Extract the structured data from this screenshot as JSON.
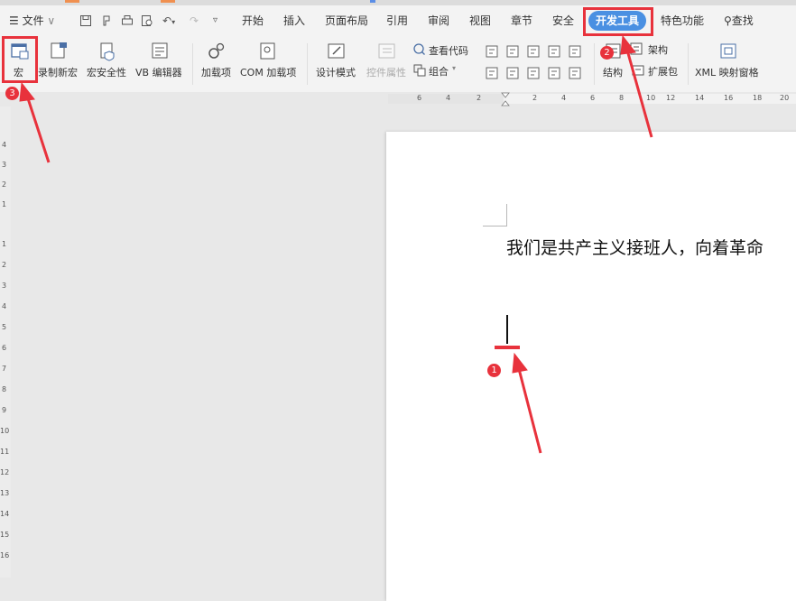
{
  "menubar": {
    "file_label": "文件",
    "tabs": [
      "开始",
      "插入",
      "页面布局",
      "引用",
      "审阅",
      "视图",
      "章节",
      "安全",
      "开发工具",
      "特色功能"
    ],
    "active_tab": "开发工具",
    "search_label": "查找"
  },
  "ribbon": {
    "macro": "宏",
    "record_macro": "录制新宏",
    "macro_security": "宏安全性",
    "vb_editor": "VB 编辑器",
    "addins": "加载项",
    "com_addins": "COM 加载项",
    "design_mode": "设计模式",
    "control_props": "控件属性",
    "view_code": "查看代码",
    "group": "组合",
    "structure_top": "架构",
    "structure": "结构",
    "expansion_pack": "扩展包",
    "xml_pane": "XML 映射窗格"
  },
  "ruler": {
    "h_numbers": [
      "6",
      "4",
      "2",
      "2",
      "4",
      "6",
      "8",
      "10",
      "12",
      "14",
      "16",
      "18",
      "20"
    ],
    "v_top_numbers": [
      "4",
      "3",
      "2",
      "1"
    ],
    "v_numbers": [
      "1",
      "2",
      "3",
      "4",
      "5",
      "6",
      "7",
      "8",
      "9",
      "10",
      "11",
      "12",
      "13",
      "14",
      "15",
      "16"
    ]
  },
  "document": {
    "text": "我们是共产主义接班人，向着革命"
  },
  "callouts": [
    "1",
    "2",
    "3"
  ],
  "colors": {
    "accent": "#e8323c",
    "active_tab_bg": "#4a90e2"
  }
}
